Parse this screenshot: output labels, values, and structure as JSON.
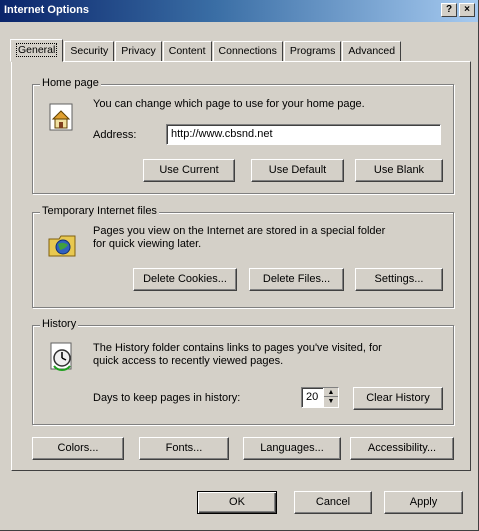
{
  "window": {
    "title": "Internet Options",
    "help_glyph": "?",
    "close_glyph": "×"
  },
  "tabs": [
    "General",
    "Security",
    "Privacy",
    "Content",
    "Connections",
    "Programs",
    "Advanced"
  ],
  "home_page": {
    "group_title": "Home page",
    "description": "You can change which page to use for your home page.",
    "address_label": "Address:",
    "address_value": "http://www.cbsnd.net",
    "use_current": "Use Current",
    "use_default": "Use Default",
    "use_blank": "Use Blank"
  },
  "temp_files": {
    "group_title": "Temporary Internet files",
    "description_line1": "Pages you view on the Internet are stored in a special folder",
    "description_line2": "for quick viewing later.",
    "delete_cookies": "Delete Cookies...",
    "delete_files": "Delete Files...",
    "settings": "Settings..."
  },
  "history": {
    "group_title": "History",
    "description_line1": "The History folder contains links to pages you've visited, for",
    "description_line2": "quick access to recently viewed pages.",
    "days_label": "Days to keep pages in history:",
    "days_value": "20",
    "clear_history": "Clear History"
  },
  "bottom_buttons": {
    "colors": "Colors...",
    "fonts": "Fonts...",
    "languages": "Languages...",
    "accessibility": "Accessibility..."
  },
  "dialog_buttons": {
    "ok": "OK",
    "cancel": "Cancel",
    "apply": "Apply"
  }
}
